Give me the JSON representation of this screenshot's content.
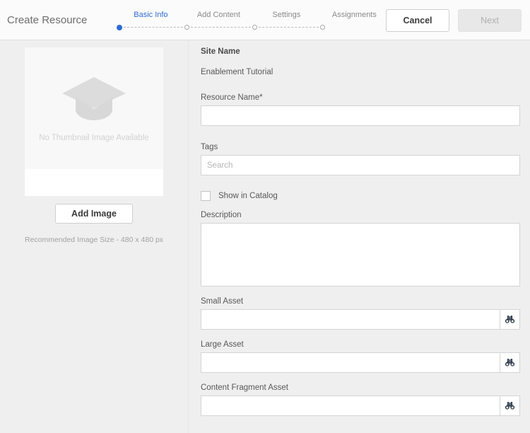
{
  "header": {
    "title": "Create Resource",
    "steps": [
      {
        "label": "Basic Info",
        "state": "active"
      },
      {
        "label": "Add Content",
        "state": "inactive"
      },
      {
        "label": "Settings",
        "state": "inactive"
      },
      {
        "label": "Assignments",
        "state": "inactive"
      }
    ],
    "buttons": {
      "cancel": "Cancel",
      "next": "Next"
    }
  },
  "thumbnail": {
    "icon": "graduation-cap-icon",
    "empty_text": "No Thumbnail Image Available",
    "add_image_label": "Add Image",
    "recommended_size": "Recommended Image Size - 480 x 480 px"
  },
  "form": {
    "site_name_label": "Site Name",
    "site_name_value": "Enablement Tutorial",
    "resource_name_label": "Resource Name*",
    "resource_name_value": "",
    "resource_name_placeholder": "",
    "tags_label": "Tags",
    "tags_value": "",
    "tags_placeholder": "Search",
    "show_in_catalog_label": "Show in Catalog",
    "show_in_catalog_checked": false,
    "description_label": "Description",
    "description_value": "",
    "assets": [
      {
        "label": "Small Asset",
        "value": "",
        "browse_icon": "binoculars-icon"
      },
      {
        "label": "Large Asset",
        "value": "",
        "browse_icon": "binoculars-icon"
      },
      {
        "label": "Content Fragment Asset",
        "value": "",
        "browse_icon": "binoculars-icon"
      }
    ]
  },
  "colors": {
    "accent": "#2b6cd4",
    "page_background": "#efefef",
    "header_background": "#fbfbfb",
    "field_background": "#ffffff",
    "placeholder": "#b5b5b5"
  }
}
